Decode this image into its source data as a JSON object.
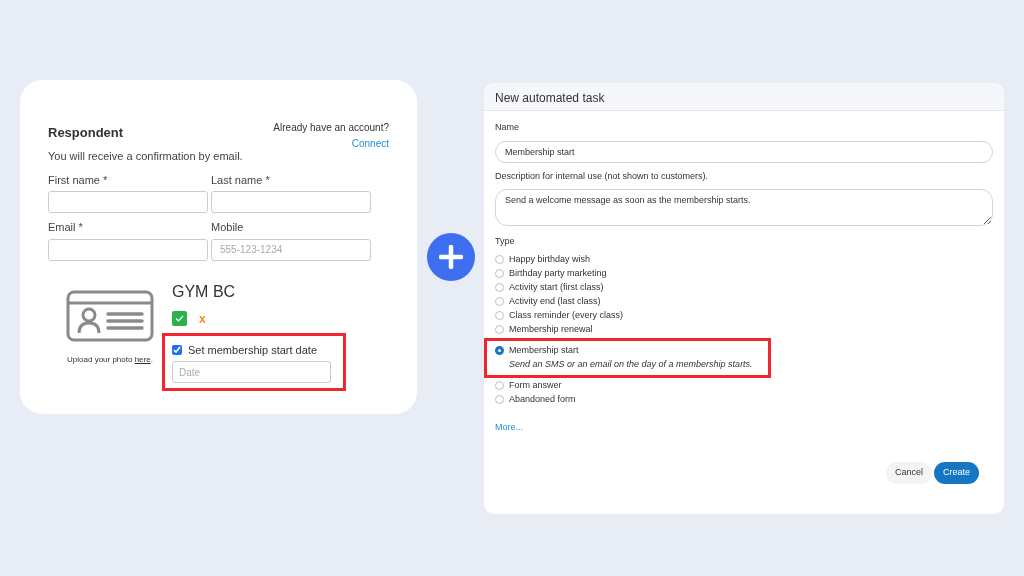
{
  "respondent_form": {
    "title": "Respondent",
    "account_prompt": "Already have an account?",
    "connect_link": "Connect",
    "subtitle": "You will receive a confirmation by email.",
    "fields": [
      {
        "label": "First name *"
      },
      {
        "label": "Last name *"
      },
      {
        "label": "Email *"
      },
      {
        "label": "Mobile",
        "placeholder": "555-123-1234"
      }
    ],
    "photo_caption": {
      "text": "Upload your photo ",
      "link": "here",
      "suffix": "."
    },
    "gym_name": "GYM BC",
    "reject_mark": "x",
    "membership_checkbox": {
      "label": "Set membership start date",
      "checked": true
    },
    "date_field": {
      "placeholder": "Date"
    }
  },
  "task_dialog": {
    "title": "New automated task",
    "name_label": "Name",
    "name_value": "Membership start",
    "description_label": "Description for internal use (not shown to customers).",
    "description_value": "Send a welcome message as soon as the membership starts.",
    "type_label": "Type",
    "types": [
      {
        "label": "Happy birthday wish",
        "selected": false
      },
      {
        "label": "Birthday party marketing",
        "selected": false
      },
      {
        "label": "Activity start (first class)",
        "selected": false
      },
      {
        "label": "Activity end (last class)",
        "selected": false
      },
      {
        "label": "Class reminder (every class)",
        "selected": false
      },
      {
        "label": "Membership renewal",
        "selected": false
      },
      {
        "label": "Membership start",
        "selected": true,
        "description": "Send an SMS or an email on the day of a membership starts."
      },
      {
        "label": "Form answer",
        "selected": false
      },
      {
        "label": "Abandoned form",
        "selected": false
      }
    ],
    "more_link": "More...",
    "buttons": [
      {
        "label": "Cancel",
        "kind": "secondary"
      },
      {
        "label": "Create",
        "kind": "primary"
      }
    ]
  }
}
